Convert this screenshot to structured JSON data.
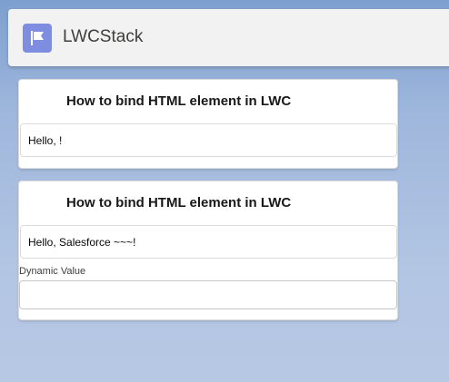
{
  "app": {
    "title": "LWCStack",
    "icon": "flag-icon",
    "icon_color": "#7f8de1"
  },
  "cards": [
    {
      "title": "How to bind HTML element in LWC",
      "greeting": "Hello, !"
    },
    {
      "title": "How to bind HTML element in LWC",
      "greeting": "Hello, Salesforce ~~~!",
      "input_label": "Dynamic Value",
      "input_value": ""
    }
  ]
}
